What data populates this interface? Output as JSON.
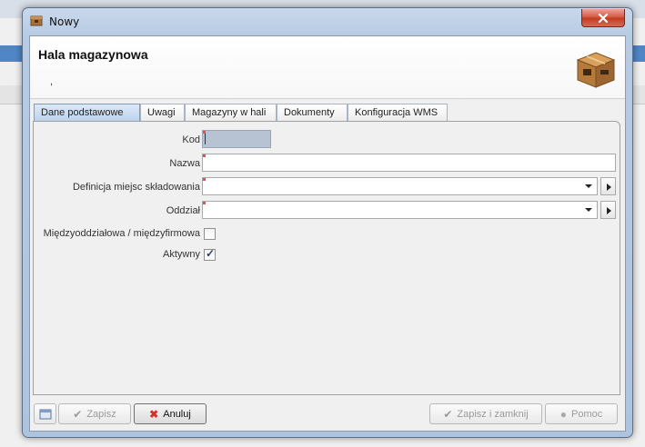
{
  "window": {
    "title": "Nowy",
    "icon": "box-icon"
  },
  "header": {
    "title": "Hala magazynowa",
    "subtitle": ",",
    "icon": "warehouse-box-icon"
  },
  "tabs": [
    {
      "label": "Dane podstawowe",
      "active": true
    },
    {
      "label": "Uwagi",
      "active": false
    },
    {
      "label": "Magazyny w hali",
      "active": false
    },
    {
      "label": "Dokumenty",
      "active": false
    },
    {
      "label": "Konfiguracja WMS",
      "active": false
    }
  ],
  "form": {
    "kod": {
      "label": "Kod",
      "value": ""
    },
    "nazwa": {
      "label": "Nazwa",
      "value": ""
    },
    "definicja": {
      "label": "Definicja miejsc składowania",
      "value": ""
    },
    "oddzial": {
      "label": "Oddział",
      "value": ""
    },
    "miedzy": {
      "label": "Międzyoddziałowa / międzyfirmowa",
      "checked": false
    },
    "aktywny": {
      "label": "Aktywny",
      "checked": true
    }
  },
  "footer": {
    "zapisz": "Zapisz",
    "anuluj": "Anuluj",
    "zapisz_zamknij": "Zapisz i zamknij",
    "pomoc": "Pomoc"
  },
  "colors": {
    "required_marker": "#e05050",
    "active_tab": "#bcd3ee",
    "close_button": "#c23a22"
  }
}
